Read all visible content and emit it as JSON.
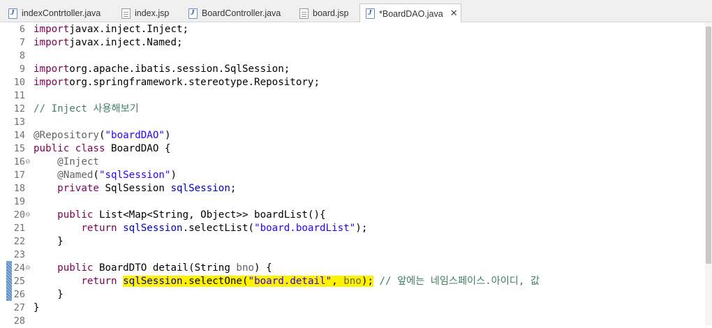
{
  "tabs": [
    {
      "label": "indexContrtoller.java",
      "icon": "java-file-icon",
      "active": false
    },
    {
      "label": "index.jsp",
      "icon": "jsp-file-icon",
      "active": false
    },
    {
      "label": "BoardController.java",
      "icon": "java-file-icon",
      "active": false
    },
    {
      "label": "board.jsp",
      "icon": "jsp-file-icon",
      "active": false
    },
    {
      "label": "*BoardDAO.java",
      "icon": "java-file-icon",
      "active": true,
      "close_icon": "close-icon"
    }
  ],
  "editor": {
    "lines": [
      {
        "num": "6",
        "fold": "",
        "segs": [
          [
            "kw",
            "import"
          ],
          [
            "",
            "javax.inject.Inject;"
          ]
        ]
      },
      {
        "num": "7",
        "fold": "",
        "segs": [
          [
            "kw",
            "import"
          ],
          [
            "",
            "javax.inject.Named;"
          ]
        ]
      },
      {
        "num": "8",
        "fold": "",
        "segs": []
      },
      {
        "num": "9",
        "fold": "",
        "segs": [
          [
            "kw",
            "import"
          ],
          [
            "",
            "org.apache.ibatis.session.SqlSession;"
          ]
        ]
      },
      {
        "num": "10",
        "fold": "",
        "segs": [
          [
            "kw",
            "import"
          ],
          [
            "",
            "org.springframework.stereotype.Repository;"
          ]
        ]
      },
      {
        "num": "11",
        "fold": "",
        "segs": []
      },
      {
        "num": "12",
        "fold": "",
        "segs": [
          [
            "cm",
            "// Inject 사용해보기"
          ]
        ]
      },
      {
        "num": "13",
        "fold": "",
        "segs": []
      },
      {
        "num": "14",
        "fold": "",
        "segs": [
          [
            "an",
            "@Repository"
          ],
          [
            "",
            "("
          ],
          [
            "str",
            "\"boardDAO\""
          ],
          [
            "",
            ")"
          ]
        ]
      },
      {
        "num": "15",
        "fold": "",
        "segs": [
          [
            "kw",
            "public class"
          ],
          [
            "",
            " BoardDAO {"
          ]
        ]
      },
      {
        "num": "16",
        "fold": "⊖",
        "segs": [
          [
            "",
            "    "
          ],
          [
            "an",
            "@Inject"
          ]
        ]
      },
      {
        "num": "17",
        "fold": "",
        "segs": [
          [
            "",
            "    "
          ],
          [
            "an",
            "@Named"
          ],
          [
            "",
            "("
          ],
          [
            "str",
            "\"sqlSession\""
          ],
          [
            "",
            ")"
          ]
        ]
      },
      {
        "num": "18",
        "fold": "",
        "segs": [
          [
            "",
            "    "
          ],
          [
            "kw",
            "private"
          ],
          [
            "",
            " SqlSession "
          ],
          [
            "fld",
            "sqlSession"
          ],
          [
            "",
            ";"
          ]
        ]
      },
      {
        "num": "19",
        "fold": "",
        "segs": []
      },
      {
        "num": "20",
        "fold": "⊖",
        "segs": [
          [
            "",
            "    "
          ],
          [
            "kw",
            "public"
          ],
          [
            "",
            " List<Map<String, Object>> boardList(){"
          ]
        ]
      },
      {
        "num": "21",
        "fold": "",
        "segs": [
          [
            "",
            "        "
          ],
          [
            "kw",
            "return"
          ],
          [
            "",
            " "
          ],
          [
            "fld",
            "sqlSession"
          ],
          [
            "",
            ".selectList("
          ],
          [
            "str",
            "\"board.boardList\""
          ],
          [
            "",
            ");"
          ]
        ]
      },
      {
        "num": "22",
        "fold": "",
        "segs": [
          [
            "",
            "    }"
          ]
        ]
      },
      {
        "num": "23",
        "fold": "",
        "segs": []
      },
      {
        "num": "24",
        "fold": "⊖",
        "segs": [
          [
            "",
            "    "
          ],
          [
            "kw",
            "public"
          ],
          [
            "",
            " BoardDTO detail(String "
          ],
          [
            "an",
            "bno"
          ],
          [
            "",
            ") {"
          ]
        ]
      },
      {
        "num": "25",
        "fold": "",
        "segs": [
          [
            "",
            "        "
          ],
          [
            "kw",
            "return"
          ],
          [
            "",
            " "
          ],
          [
            "fld hl",
            "sqlSession"
          ],
          [
            "hl",
            ".selectOne("
          ],
          [
            "str hl",
            "\"board.detail\""
          ],
          [
            "hl",
            ", "
          ],
          [
            "an hl",
            "bno"
          ],
          [
            "hl",
            ");"
          ],
          [
            "",
            " "
          ],
          [
            "cm",
            "// 앞에는 네임스페이스.아이디, 값"
          ]
        ]
      },
      {
        "num": "26",
        "fold": "",
        "segs": [
          [
            "",
            "    }"
          ]
        ]
      },
      {
        "num": "27",
        "fold": "",
        "segs": [
          [
            "",
            "}"
          ]
        ]
      },
      {
        "num": "28",
        "fold": "",
        "segs": []
      }
    ]
  }
}
